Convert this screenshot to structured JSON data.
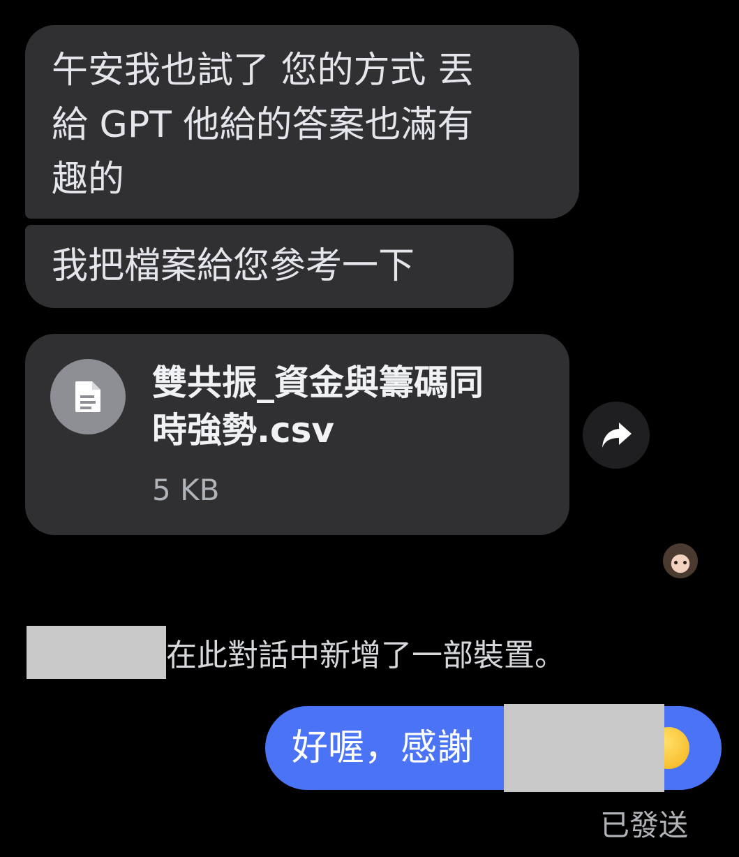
{
  "messages": {
    "msg1_line1": "午安我也試了 您的方式 丟",
    "msg1_line2": "給 GPT 他給的答案也滿有",
    "msg1_line3": "趣的",
    "msg2": "我把檔案給您參考一下"
  },
  "file": {
    "name_line1": "雙共振_資金與籌碼同",
    "name_line2": "時強勢.csv",
    "size": "5 KB",
    "icon": "document-icon"
  },
  "actions": {
    "forward_icon": "forward-arrow-icon"
  },
  "system_notice": {
    "text": "在此對話中新增了一部裝置。"
  },
  "outgoing": {
    "text": "好喔，感謝",
    "emoji": "slightly-smiling-face-emoji",
    "status": "已發送"
  },
  "colors": {
    "background": "#000000",
    "incoming_bubble": "#303033",
    "outgoing_bubble": "#4a73f5",
    "redaction": "#c8c8c8"
  }
}
